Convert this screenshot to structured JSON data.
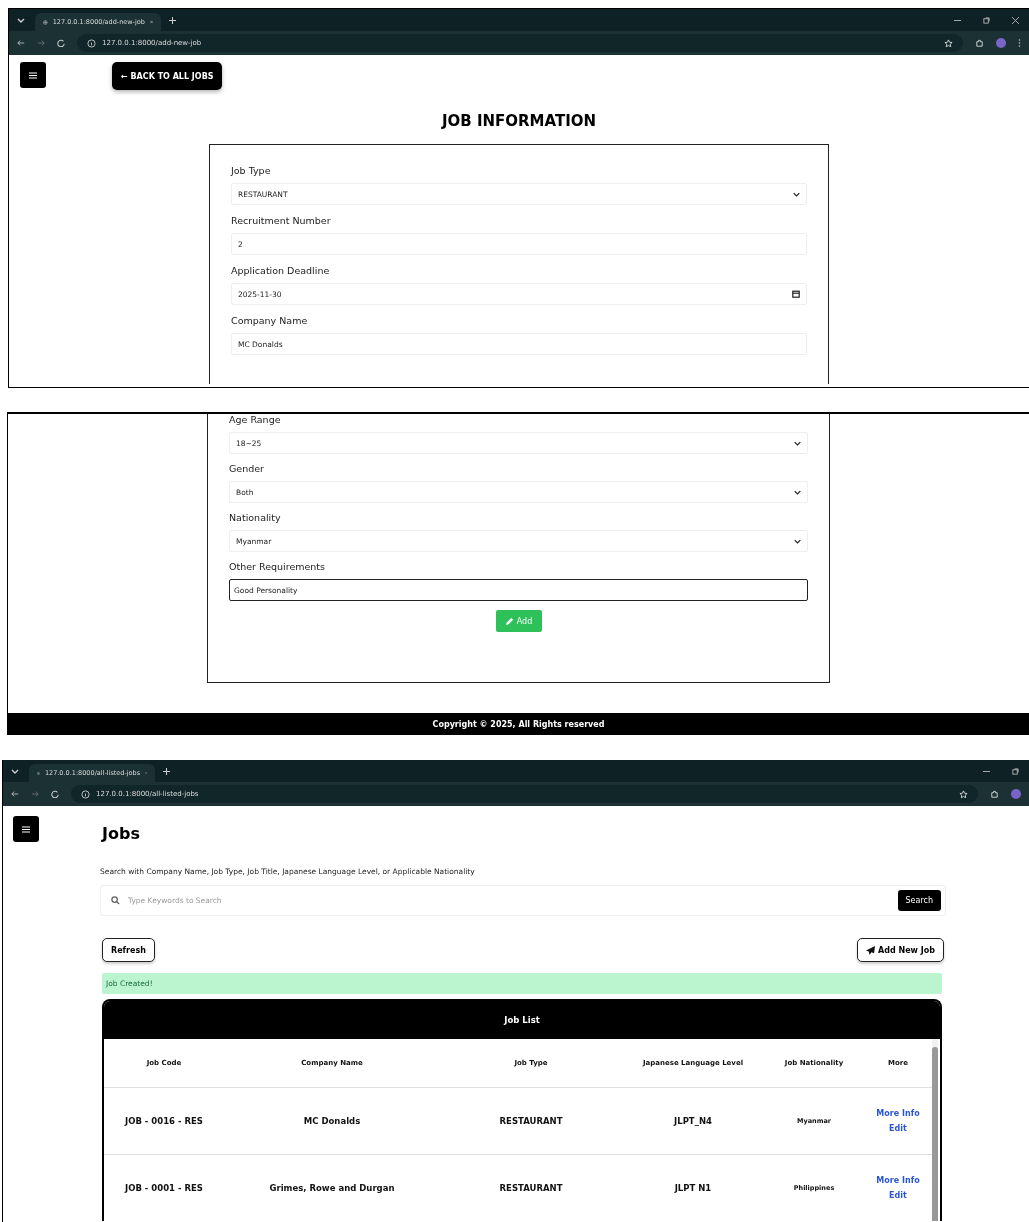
{
  "add_job_window": {
    "tab_title": "127.0.0.1:8000/add-new-job",
    "url": "127.0.0.1:8000/add-new-job",
    "back_button": "← BACK TO ALL JOBS",
    "title": "JOB INFORMATION",
    "fields": [
      {
        "label": "Job Type",
        "kind": "select",
        "value": "RESTAURANT",
        "focused": false
      },
      {
        "label": "Recruitment Number",
        "kind": "input",
        "value": "2",
        "focused": false
      },
      {
        "label": "Application Deadline",
        "kind": "date",
        "value": "2025-11-30",
        "focused": false
      },
      {
        "label": "Company Name",
        "kind": "input",
        "value": "MC Donalds",
        "focused": false
      }
    ]
  },
  "add_job_scrolled": {
    "fields": [
      {
        "label": "Age Range",
        "kind": "select",
        "value": "18~25",
        "focused": false
      },
      {
        "label": "Gender",
        "kind": "select",
        "value": "Both",
        "focused": false
      },
      {
        "label": "Nationality",
        "kind": "select",
        "value": "Myanmar",
        "focused": false
      },
      {
        "label": "Other Requirements",
        "kind": "input",
        "value": "Good Personality",
        "focused": true
      }
    ],
    "add_button": "Add",
    "footer": "Copyright © 2025, All Rights reserved"
  },
  "jobs_window": {
    "tab_title": "127.0.0.1:8000/all-listed-jobs",
    "url": "127.0.0.1:8000/all-listed-jobs",
    "title": "Jobs",
    "search_hint": "Search with Company Name, Job Type, Job Title, Japanese Language Level, or Applicable Nationality",
    "search": {
      "placeholder": "Type Keywords to Search"
    },
    "search_button": "Search",
    "refresh_button": "Refresh",
    "add_button": "Add New Job",
    "alert": "Job Created!",
    "table": {
      "title": "Job List",
      "columns": [
        "Job Code",
        "Company Name",
        "Job Type",
        "Japanese Language Level",
        "Job Nationality",
        "More"
      ],
      "rows": [
        {
          "cells": [
            "JOB - 0016 - RES",
            "MC Donalds",
            "RESTAURANT",
            "JLPT_N4",
            "Myanmar"
          ],
          "links": [
            "More Info",
            "Edit"
          ]
        },
        {
          "cells": [
            "JOB - 0001 - RES",
            "Grimes, Rowe and Durgan",
            "RESTAURANT",
            "JLPT N1",
            "Philippines"
          ],
          "links": [
            "More Info",
            "Edit"
          ]
        }
      ]
    }
  }
}
